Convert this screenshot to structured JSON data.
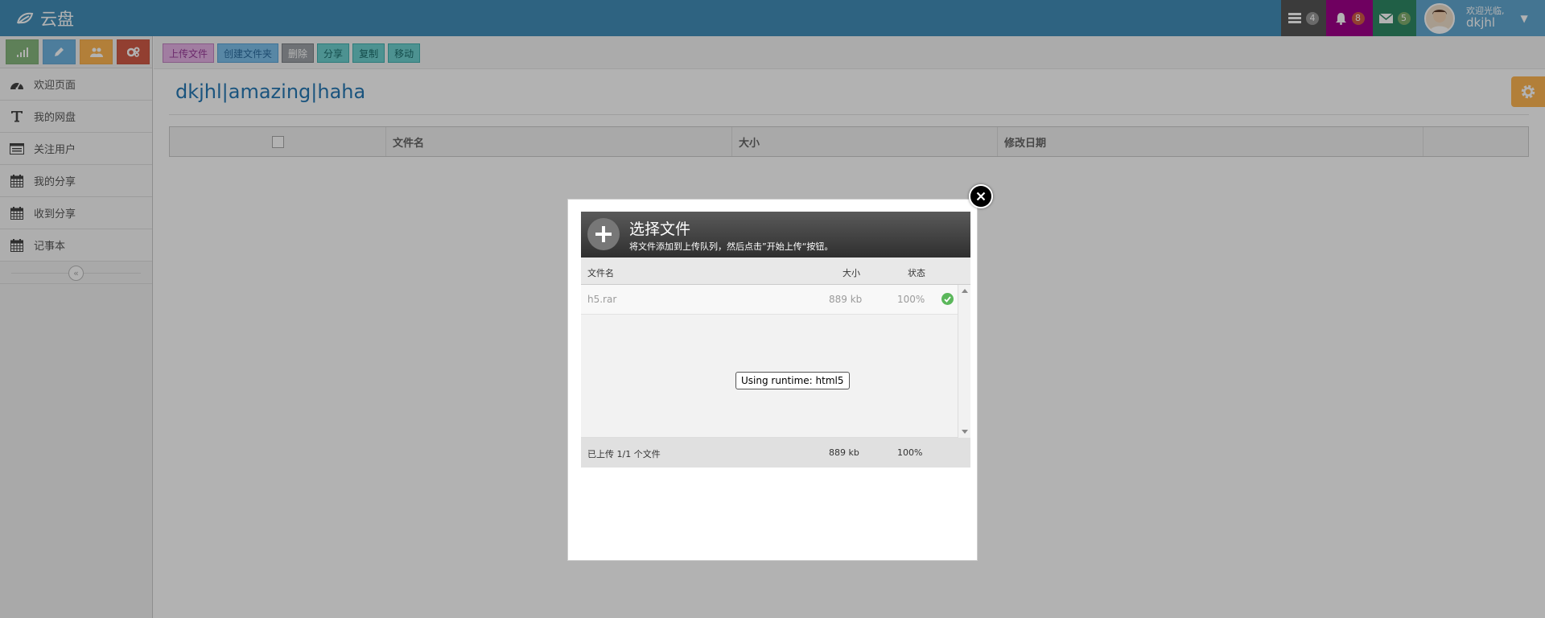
{
  "navbar": {
    "brand": "云盘",
    "tasks_count": "4",
    "notifications_count": "8",
    "messages_count": "5",
    "user_welcome": "欢迎光临,",
    "user_name": "dkjhl",
    "colors": {
      "bar": "#438eb9",
      "tasks": "#555555",
      "notifications": "#a0008a",
      "messages": "#2e8965"
    }
  },
  "sidebar": {
    "shortcuts": [
      {
        "icon": "signal-icon",
        "color": "#87b87f"
      },
      {
        "icon": "pencil-icon",
        "color": "#6fb3e0"
      },
      {
        "icon": "users-icon",
        "color": "#ffb752"
      },
      {
        "icon": "cogs-icon",
        "color": "#d15b47"
      }
    ],
    "items": [
      {
        "label": "欢迎页面",
        "icon": "dashboard-icon"
      },
      {
        "label": "我的网盘",
        "icon": "text-icon"
      },
      {
        "label": "关注用户",
        "icon": "list-icon"
      },
      {
        "label": "我的分享",
        "icon": "calendar-icon"
      },
      {
        "label": "收到分享",
        "icon": "calendar-icon"
      },
      {
        "label": "记事本",
        "icon": "calendar-icon"
      }
    ]
  },
  "toolbar": {
    "upload": "上传文件",
    "create_folder": "创建文件夹",
    "delete": "删除",
    "share": "分享",
    "copy": "复制",
    "move": "移动"
  },
  "main": {
    "title": "dkjhl|amazing|haha",
    "table_headers": {
      "name": "文件名",
      "size": "大小",
      "modified": "修改日期"
    }
  },
  "upload_dialog": {
    "title": "选择文件",
    "subtitle": "将文件添加到上传队列，然后点击”开始上传“按钮。",
    "columns": {
      "name": "文件名",
      "size": "大小",
      "status": "状态"
    },
    "files": [
      {
        "name": "h5.rar",
        "size": "889 kb",
        "percent": "100%"
      }
    ],
    "runtime": "Using runtime: html5",
    "footer": {
      "summary": "已上传 1/1 个文件",
      "total_size": "889 kb",
      "percent": "100%"
    }
  }
}
